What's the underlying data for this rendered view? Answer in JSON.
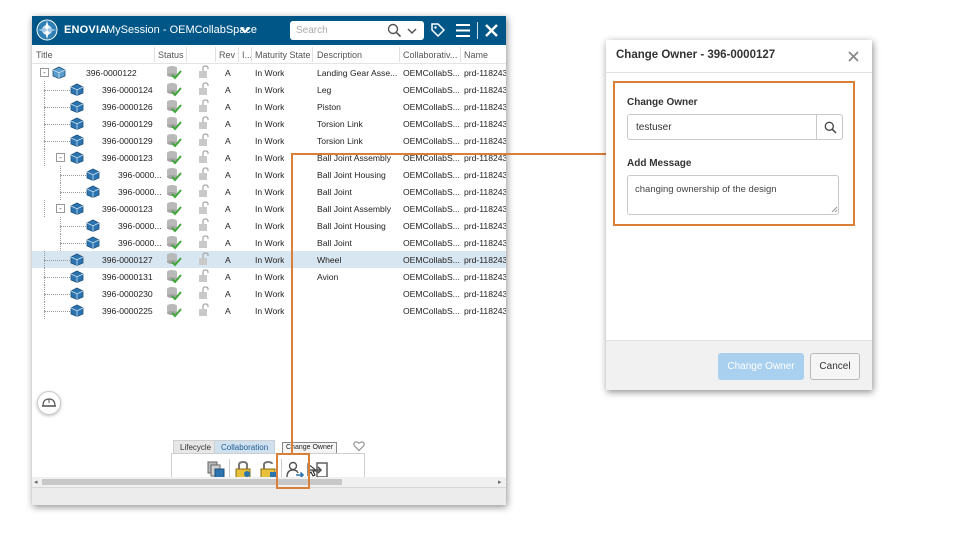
{
  "app": {
    "brand": "ENOVIA",
    "session": "MySession - OEMCollabSpace",
    "search_placeholder": "Search"
  },
  "columns": {
    "title": "Title",
    "status": "Status",
    "rev": "Rev",
    "i": "I...",
    "maturity": "Maturity State",
    "description": "Description",
    "collab": "Collaborativ...",
    "name": "Name"
  },
  "rows": [
    {
      "title": "396-0000122",
      "rev": "A",
      "maturity": "In Work",
      "description": "Landing Gear Asse...",
      "collab": "OEMCollabS...",
      "name": "prd-118243",
      "level": 0,
      "expander": "-"
    },
    {
      "title": "396-0000124",
      "rev": "A",
      "maturity": "In Work",
      "description": "Leg",
      "collab": "OEMCollabS...",
      "name": "prd-118243",
      "level": 1,
      "expander": ""
    },
    {
      "title": "396-0000126",
      "rev": "A",
      "maturity": "In Work",
      "description": "Piston",
      "collab": "OEMCollabS...",
      "name": "prd-118243",
      "level": 1,
      "expander": ""
    },
    {
      "title": "396-0000129",
      "rev": "A",
      "maturity": "In Work",
      "description": "Torsion Link",
      "collab": "OEMCollabS...",
      "name": "prd-118243",
      "level": 1,
      "expander": ""
    },
    {
      "title": "396-0000129",
      "rev": "A",
      "maturity": "In Work",
      "description": "Torsion Link",
      "collab": "OEMCollabS...",
      "name": "prd-118243",
      "level": 1,
      "expander": ""
    },
    {
      "title": "396-0000123",
      "rev": "A",
      "maturity": "In Work",
      "description": "Ball Joint Assembly",
      "collab": "OEMCollabS...",
      "name": "prd-118243",
      "level": 1,
      "expander": "-"
    },
    {
      "title": "396-0000...",
      "rev": "A",
      "maturity": "In Work",
      "description": "Ball Joint Housing",
      "collab": "OEMCollabS...",
      "name": "prd-118243",
      "level": 2,
      "expander": ""
    },
    {
      "title": "396-0000...",
      "rev": "A",
      "maturity": "In Work",
      "description": "Ball Joint",
      "collab": "OEMCollabS...",
      "name": "prd-118243",
      "level": 2,
      "expander": ""
    },
    {
      "title": "396-0000123",
      "rev": "A",
      "maturity": "In Work",
      "description": "Ball Joint Assembly",
      "collab": "OEMCollabS...",
      "name": "prd-118243",
      "level": 1,
      "expander": "-"
    },
    {
      "title": "396-0000...",
      "rev": "A",
      "maturity": "In Work",
      "description": "Ball Joint Housing",
      "collab": "OEMCollabS...",
      "name": "prd-118243",
      "level": 2,
      "expander": ""
    },
    {
      "title": "396-0000...",
      "rev": "A",
      "maturity": "In Work",
      "description": "Ball Joint",
      "collab": "OEMCollabS...",
      "name": "prd-118243",
      "level": 2,
      "expander": ""
    },
    {
      "title": "396-0000127",
      "rev": "A",
      "maturity": "In Work",
      "description": "Wheel",
      "collab": "OEMCollabS...",
      "name": "prd-118243",
      "level": 1,
      "expander": "",
      "selected": true
    },
    {
      "title": "396-0000131",
      "rev": "A",
      "maturity": "In Work",
      "description": "Avion",
      "collab": "OEMCollabS...",
      "name": "prd-118243",
      "level": 1,
      "expander": ""
    },
    {
      "title": "396-0000230",
      "rev": "A",
      "maturity": "In Work",
      "description": "",
      "collab": "OEMCollabS...",
      "name": "prd-118243",
      "level": 1,
      "expander": ""
    },
    {
      "title": "396-0000225",
      "rev": "A",
      "maturity": "In Work",
      "description": "",
      "collab": "OEMCollabS...",
      "name": "prd-118243",
      "level": 1,
      "expander": ""
    }
  ],
  "action_bar": {
    "tabs": [
      "Lifecycle",
      "Collaboration"
    ],
    "active_tab": "Collaboration",
    "tooltip": "Change Owner",
    "icons": [
      "multi-objects-icon",
      "lock-icon",
      "unlock-icon",
      "change-owner-icon",
      "transfer-icon"
    ]
  },
  "dialog": {
    "title": "Change Owner - 396-0000127",
    "owner_label": "Change Owner",
    "owner_value": "testuser",
    "message_label": "Add Message",
    "message_value": "changing ownership of the design",
    "submit_label": "Change Owner",
    "cancel_label": "Cancel"
  },
  "colors": {
    "header": "#005686",
    "highlight": "#d87f3a",
    "selected_row": "#d8e6f1",
    "submit_button": "#a9d0ee"
  }
}
